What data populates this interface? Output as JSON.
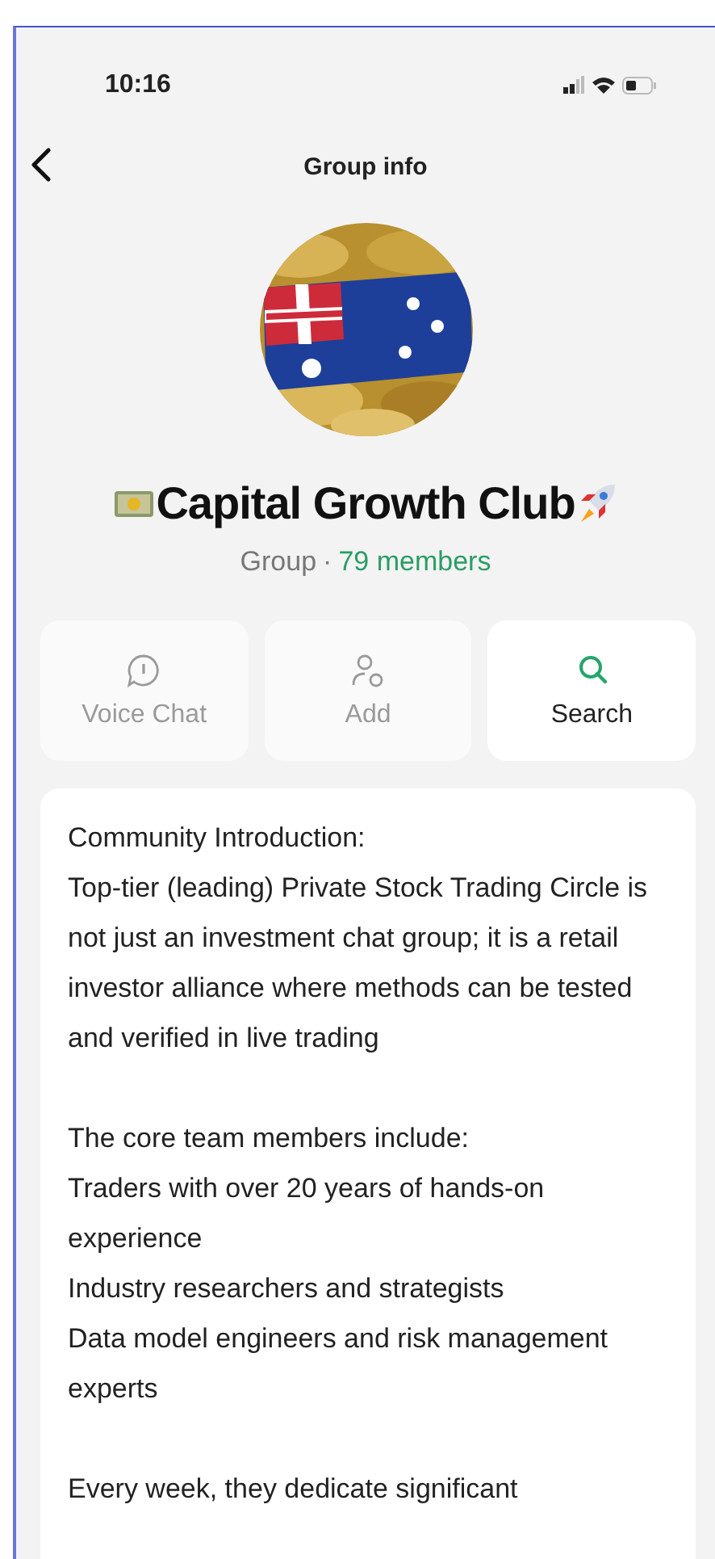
{
  "status_bar": {
    "time": "10:16"
  },
  "nav": {
    "title": "Group info"
  },
  "group": {
    "name": "Capital Growth Club",
    "type": "Group",
    "separator": "·",
    "members": "79 members"
  },
  "actions": [
    {
      "label": "Voice Chat",
      "kind": "voice",
      "disabled": true
    },
    {
      "label": "Add",
      "kind": "add",
      "disabled": true
    },
    {
      "label": "Search",
      "kind": "search",
      "disabled": false
    }
  ],
  "description": [
    [
      "Community Introduction:",
      "Top-tier (leading) Private Stock Trading Circle is not just an investment chat group; it is a retail investor alliance where methods can be tested and verified in live trading"
    ],
    [
      "The core team members include:",
      "Traders with over 20 years of hands-on experience",
      "Industry researchers and strategists",
      "Data model engineers and risk management experts"
    ],
    [
      "Every week, they dedicate significant"
    ]
  ]
}
